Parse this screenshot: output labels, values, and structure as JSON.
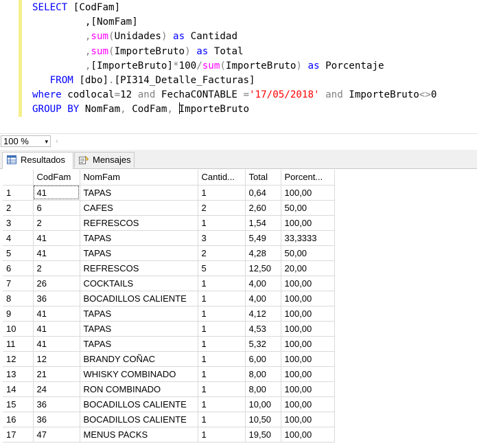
{
  "editor": {
    "lines": [
      [
        {
          "t": "SELECT",
          "c": "kw"
        },
        {
          "t": " [CodFam]",
          "c": ""
        }
      ],
      [
        {
          "t": "         ,[NomFam]",
          "c": ""
        }
      ],
      [
        {
          "t": "         ,",
          "c": "gr"
        },
        {
          "t": "sum",
          "c": "fn"
        },
        {
          "t": "(",
          "c": "gr"
        },
        {
          "t": "Unidades",
          "c": ""
        },
        {
          "t": ") ",
          "c": "gr"
        },
        {
          "t": "as",
          "c": "kw"
        },
        {
          "t": " Cantidad",
          "c": ""
        }
      ],
      [
        {
          "t": "         ,",
          "c": "gr"
        },
        {
          "t": "sum",
          "c": "fn"
        },
        {
          "t": "(",
          "c": "gr"
        },
        {
          "t": "ImporteBruto",
          "c": ""
        },
        {
          "t": ") ",
          "c": "gr"
        },
        {
          "t": "as",
          "c": "kw"
        },
        {
          "t": " Total",
          "c": ""
        }
      ],
      [
        {
          "t": "         ,",
          "c": "gr"
        },
        {
          "t": "[ImporteBruto]",
          "c": ""
        },
        {
          "t": "*",
          "c": "gr"
        },
        {
          "t": "100",
          "c": ""
        },
        {
          "t": "/",
          "c": "gr"
        },
        {
          "t": "sum",
          "c": "fn"
        },
        {
          "t": "(",
          "c": "gr"
        },
        {
          "t": "ImporteBruto",
          "c": ""
        },
        {
          "t": ") ",
          "c": "gr"
        },
        {
          "t": "as",
          "c": "kw"
        },
        {
          "t": " Porcentaje",
          "c": ""
        }
      ],
      [
        {
          "t": "   FROM",
          "c": "kw"
        },
        {
          "t": " [dbo]",
          "c": ""
        },
        {
          "t": ".",
          "c": "gr"
        },
        {
          "t": "[PI314_Detalle_Facturas]",
          "c": ""
        }
      ],
      [
        {
          "t": "where",
          "c": "kw"
        },
        {
          "t": " codlocal",
          "c": ""
        },
        {
          "t": "=",
          "c": "gr"
        },
        {
          "t": "12 ",
          "c": ""
        },
        {
          "t": "and",
          "c": "gr"
        },
        {
          "t": " FechaCONTABLE ",
          "c": ""
        },
        {
          "t": "=",
          "c": "gr"
        },
        {
          "t": "'17/05/2018'",
          "c": "str"
        },
        {
          "t": " ",
          "c": ""
        },
        {
          "t": "and",
          "c": "gr"
        },
        {
          "t": " ImporteBruto",
          "c": ""
        },
        {
          "t": "<>",
          "c": "gr"
        },
        {
          "t": "0",
          "c": ""
        }
      ],
      [
        {
          "t": "GROUP BY",
          "c": "kw"
        },
        {
          "t": " NomFam",
          "c": ""
        },
        {
          "t": ",",
          "c": "gr"
        },
        {
          "t": " CodFam",
          "c": ""
        },
        {
          "t": ",",
          "c": "gr"
        },
        {
          "t": " ",
          "c": ""
        },
        {
          "t": "|caret|",
          "c": "caret"
        },
        {
          "t": "ImporteBruto",
          "c": ""
        }
      ]
    ]
  },
  "zoom": {
    "value": "100 %",
    "arrow": "▾",
    "scroll_left": "‹"
  },
  "tabs": [
    {
      "label": "Resultados",
      "icon": "grid-results-icon",
      "active": true
    },
    {
      "label": "Mensajes",
      "icon": "messages-icon",
      "active": false
    }
  ],
  "grid": {
    "columns": [
      "",
      "CodFam",
      "NomFam",
      "Cantid...",
      "Total",
      "Porcent..."
    ],
    "rows": [
      [
        "1",
        "41",
        "TAPAS",
        "1",
        "0,64",
        "100,00"
      ],
      [
        "2",
        "6",
        "CAFES",
        "2",
        "2,60",
        "50,00"
      ],
      [
        "3",
        "2",
        "REFRESCOS",
        "1",
        "1,54",
        "100,00"
      ],
      [
        "4",
        "41",
        "TAPAS",
        "3",
        "5,49",
        "33,3333"
      ],
      [
        "5",
        "41",
        "TAPAS",
        "2",
        "4,28",
        "50,00"
      ],
      [
        "6",
        "2",
        "REFRESCOS",
        "5",
        "12,50",
        "20,00"
      ],
      [
        "7",
        "26",
        "COCKTAILS",
        "1",
        "4,00",
        "100,00"
      ],
      [
        "8",
        "36",
        "BOCADILLOS CALIENTE",
        "1",
        "4,00",
        "100,00"
      ],
      [
        "9",
        "41",
        "TAPAS",
        "1",
        "4,12",
        "100,00"
      ],
      [
        "10",
        "41",
        "TAPAS",
        "1",
        "4,53",
        "100,00"
      ],
      [
        "11",
        "41",
        "TAPAS",
        "1",
        "5,32",
        "100,00"
      ],
      [
        "12",
        "12",
        "BRANDY COÑAC",
        "1",
        "6,00",
        "100,00"
      ],
      [
        "13",
        "21",
        "WHISKY COMBINADO",
        "1",
        "8,00",
        "100,00"
      ],
      [
        "14",
        "24",
        "RON COMBINADO",
        "1",
        "8,00",
        "100,00"
      ],
      [
        "15",
        "36",
        "BOCADILLOS CALIENTE",
        "1",
        "10,00",
        "100,00"
      ],
      [
        "16",
        "36",
        "BOCADILLOS CALIENTE",
        "1",
        "10,50",
        "100,00"
      ],
      [
        "17",
        "47",
        "MENUS PACKS",
        "1",
        "19,50",
        "100,00"
      ]
    ]
  },
  "colors": {
    "keyword": "#0000ff",
    "function": "#ff00ff",
    "operator": "#808080",
    "string": "#ff0000",
    "change_bar": "#f4ef8c"
  }
}
